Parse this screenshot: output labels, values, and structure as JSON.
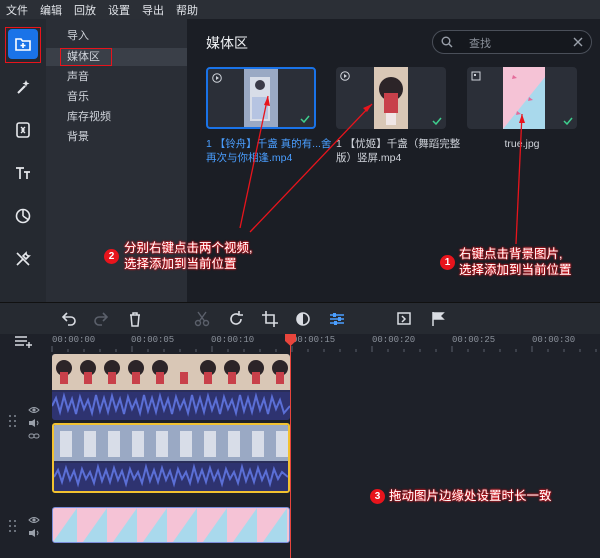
{
  "menu": [
    "文件",
    "编辑",
    "回放",
    "设置",
    "导出",
    "帮助"
  ],
  "tools": [
    {
      "name": "media-import-icon",
      "active": true
    },
    {
      "name": "magic-wand-icon"
    },
    {
      "name": "transition-icon"
    },
    {
      "name": "titles-icon"
    },
    {
      "name": "filters-icon"
    },
    {
      "name": "tools-icon"
    }
  ],
  "nav": {
    "items": [
      "导入",
      "媒体区",
      "声音",
      "音乐",
      "库存视频",
      "背景"
    ],
    "selected_index": 1
  },
  "media": {
    "title": "媒体区",
    "search_placeholder": "查找",
    "items": [
      {
        "caption": "1 【铃舟】千盏 真的有...舍再次与你相逢.mp4",
        "selected": true
      },
      {
        "caption": "1 【忧姬】千盏（舞蹈完整版）竖屏.mp4",
        "selected": false
      },
      {
        "caption": "true.jpg",
        "selected": false
      }
    ]
  },
  "annotations": [
    {
      "badge": "2",
      "text": "分别右键点击两个视频,\n选择添加到当前位置"
    },
    {
      "badge": "1",
      "text": "右键点击背景图片,\n选择添加到当前位置"
    },
    {
      "badge": "3",
      "text": "拖动图片边缘处设置时长一致"
    }
  ],
  "timeline": {
    "ticks": [
      "00:00:00",
      "00:00:05",
      "00:00:10",
      "00:00:15",
      "00:00:20",
      "00:00:25",
      "00:00:30"
    ]
  },
  "colors": {
    "accent": "#1a73e8",
    "annotation_red": "#e8141c",
    "clip_yellow": "#f2c230",
    "waveform": "#4a5bc4"
  }
}
